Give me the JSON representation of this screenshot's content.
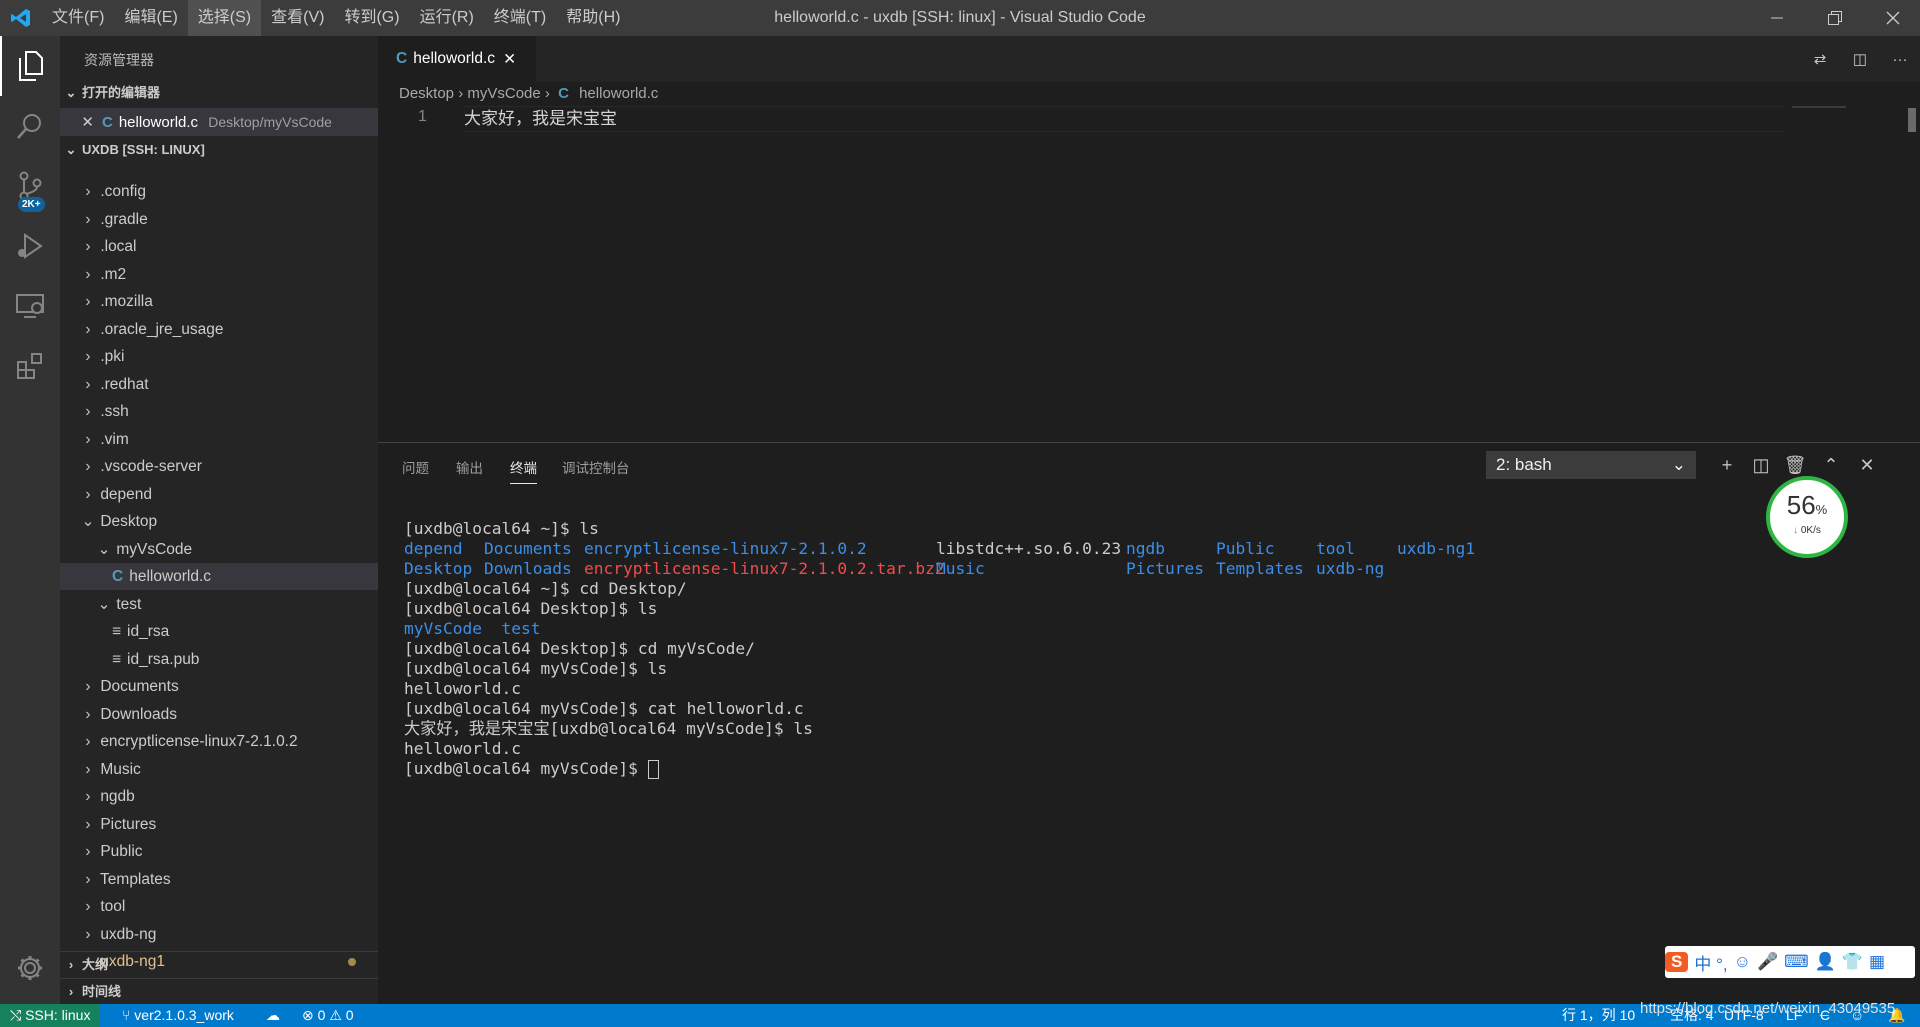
{
  "titlebar": {
    "menu": [
      "文件(F)",
      "编辑(E)",
      "选择(S)",
      "查看(V)",
      "转到(G)",
      "运行(R)",
      "终端(T)",
      "帮助(H)"
    ],
    "active_menu_index": 2,
    "window_title": "helloworld.c - uxdb [SSH: linux] - Visual Studio Code"
  },
  "activitybar": {
    "badge": "2K+",
    "icons": [
      "files-icon",
      "search-icon",
      "source-control-icon",
      "run-debug-icon",
      "remote-explorer-icon",
      "extensions-icon",
      "settings-gear-icon"
    ]
  },
  "sidebar": {
    "title": "资源管理器",
    "open_editors_header": "打开的编辑器",
    "open_editor": {
      "file": "helloworld.c",
      "path": "Desktop/myVsCode"
    },
    "workspace_header": "UXDB [SSH: LINUX]",
    "tree": [
      {
        "label": ".config",
        "depth": 0,
        "kind": "folder",
        "open": false
      },
      {
        "label": ".gradle",
        "depth": 0,
        "kind": "folder",
        "open": false
      },
      {
        "label": ".local",
        "depth": 0,
        "kind": "folder",
        "open": false
      },
      {
        "label": ".m2",
        "depth": 0,
        "kind": "folder",
        "open": false
      },
      {
        "label": ".mozilla",
        "depth": 0,
        "kind": "folder",
        "open": false
      },
      {
        "label": ".oracle_jre_usage",
        "depth": 0,
        "kind": "folder",
        "open": false
      },
      {
        "label": ".pki",
        "depth": 0,
        "kind": "folder",
        "open": false
      },
      {
        "label": ".redhat",
        "depth": 0,
        "kind": "folder",
        "open": false
      },
      {
        "label": ".ssh",
        "depth": 0,
        "kind": "folder",
        "open": false
      },
      {
        "label": ".vim",
        "depth": 0,
        "kind": "folder",
        "open": false
      },
      {
        "label": ".vscode-server",
        "depth": 0,
        "kind": "folder",
        "open": false
      },
      {
        "label": "depend",
        "depth": 0,
        "kind": "folder",
        "open": false
      },
      {
        "label": "Desktop",
        "depth": 0,
        "kind": "folder",
        "open": true
      },
      {
        "label": "myVsCode",
        "depth": 1,
        "kind": "folder",
        "open": true
      },
      {
        "label": "helloworld.c",
        "depth": 2,
        "kind": "c-file",
        "selected": true
      },
      {
        "label": "test",
        "depth": 1,
        "kind": "folder",
        "open": true
      },
      {
        "label": "id_rsa",
        "depth": 2,
        "kind": "text-file"
      },
      {
        "label": "id_rsa.pub",
        "depth": 2,
        "kind": "text-file"
      },
      {
        "label": "Documents",
        "depth": 0,
        "kind": "folder",
        "open": false
      },
      {
        "label": "Downloads",
        "depth": 0,
        "kind": "folder",
        "open": false
      },
      {
        "label": "encryptlicense-linux7-2.1.0.2",
        "depth": 0,
        "kind": "folder",
        "open": false
      },
      {
        "label": "Music",
        "depth": 0,
        "kind": "folder",
        "open": false
      },
      {
        "label": "ngdb",
        "depth": 0,
        "kind": "folder",
        "open": false
      },
      {
        "label": "Pictures",
        "depth": 0,
        "kind": "folder",
        "open": false
      },
      {
        "label": "Public",
        "depth": 0,
        "kind": "folder",
        "open": false
      },
      {
        "label": "Templates",
        "depth": 0,
        "kind": "folder",
        "open": false
      },
      {
        "label": "tool",
        "depth": 0,
        "kind": "folder",
        "open": false
      },
      {
        "label": "uxdb-ng",
        "depth": 0,
        "kind": "folder",
        "open": false
      },
      {
        "label": "uxdb-ng1",
        "depth": 0,
        "kind": "folder",
        "open": false,
        "modified": true
      }
    ],
    "outline_header": "大纲",
    "timeline_header": "时间线"
  },
  "editor": {
    "tab_label": "helloworld.c",
    "breadcrumb": [
      "Desktop",
      "myVsCode",
      "helloworld.c"
    ],
    "lines": [
      {
        "num": "1",
        "text": "大家好，我是宋宝宝"
      }
    ]
  },
  "panel": {
    "tabs": [
      "问题",
      "输出",
      "终端",
      "调试控制台"
    ],
    "active_tab_index": 2,
    "terminal_select": "2: bash",
    "terminal": {
      "p1": "[uxdb@local64 ~]$ ls",
      "ls1a": [
        "depend",
        "Documents",
        "encryptlicense-linux7-2.1.0.2",
        "libstdc++.so.6.0.23",
        "ngdb",
        "Public",
        "tool",
        "uxdb-ng1"
      ],
      "ls1b": [
        "Desktop",
        "Downloads",
        "encryptlicense-linux7-2.1.0.2.tar.bz2",
        "Music",
        "Pictures",
        "Templates",
        "uxdb-ng"
      ],
      "p2": "[uxdb@local64 ~]$ cd Desktop/",
      "p3": "[uxdb@local64 Desktop]$ ls",
      "ls2": [
        "myVsCode",
        "test"
      ],
      "p4": "[uxdb@local64 Desktop]$ cd myVsCode/",
      "p5": "[uxdb@local64 myVsCode]$ ls",
      "out1": "helloworld.c",
      "p6": "[uxdb@local64 myVsCode]$ cat helloworld.c",
      "p7": "大家好，我是宋宝宝[uxdb@local64 myVsCode]$ ls",
      "out2": "helloworld.c",
      "p8": "[uxdb@local64 myVsCode]$ "
    }
  },
  "gauge": {
    "percent": "56",
    "unit": "%",
    "speed": "0K/s"
  },
  "statusbar": {
    "remote": "SSH: linux",
    "branch": "ver2.1.0.3_work",
    "errors": "0",
    "warnings": "0",
    "position": "行 1，列 10",
    "spaces": "空格: 4",
    "encoding": "UTF-8",
    "eol": "LF",
    "language": "C"
  },
  "ime": {
    "chars": "中 °, "
  },
  "watermark": "https://blog.csdn.net/weixin_43049535",
  "colors": {
    "accent": "#007acc",
    "remote": "#16825d",
    "terminal_blue": "#3b8eea",
    "terminal_red": "#f14c4c",
    "modified_dot": "#a68a4c"
  }
}
